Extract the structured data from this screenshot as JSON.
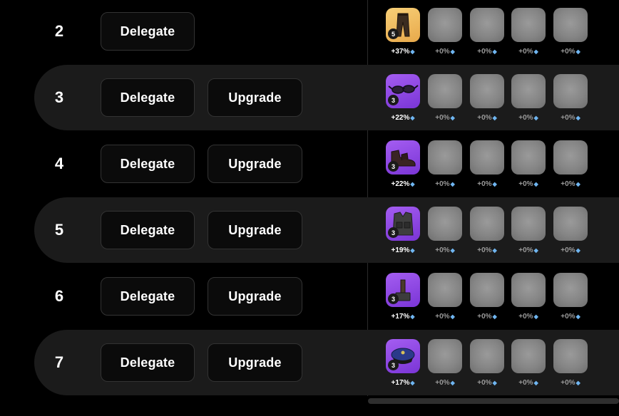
{
  "rows": [
    {
      "rank": "2",
      "delegate_label": "Delegate",
      "upgrade_label": "",
      "item": "pants",
      "level": "5",
      "rarity": "gold",
      "bonus": "+37%",
      "highlight": false
    },
    {
      "rank": "3",
      "delegate_label": "Delegate",
      "upgrade_label": "Upgrade",
      "item": "glasses",
      "level": "3",
      "rarity": "purple",
      "bonus": "+22%",
      "highlight": true
    },
    {
      "rank": "4",
      "delegate_label": "Delegate",
      "upgrade_label": "Upgrade",
      "item": "shoes",
      "level": "3",
      "rarity": "purple",
      "bonus": "+22%",
      "highlight": false
    },
    {
      "rank": "5",
      "delegate_label": "Delegate",
      "upgrade_label": "Upgrade",
      "item": "vest",
      "level": "3",
      "rarity": "purple",
      "bonus": "+19%",
      "highlight": true
    },
    {
      "rank": "6",
      "delegate_label": "Delegate",
      "upgrade_label": "Upgrade",
      "item": "hammer",
      "level": "3",
      "rarity": "purple",
      "bonus": "+17%",
      "highlight": false
    },
    {
      "rank": "7",
      "delegate_label": "Delegate",
      "upgrade_label": "Upgrade",
      "item": "police-cap",
      "level": "3",
      "rarity": "purple",
      "bonus": "+17%",
      "highlight": true
    }
  ],
  "empty_slot_bonus": "+0%",
  "gem_icon": "diamond-icon",
  "colors": {
    "background": "#000000",
    "row_highlight": "#1b1b1b",
    "gold_rarity": "#f2be62",
    "purple_rarity": "#8e47e6",
    "gem": "#6fb5f0"
  }
}
